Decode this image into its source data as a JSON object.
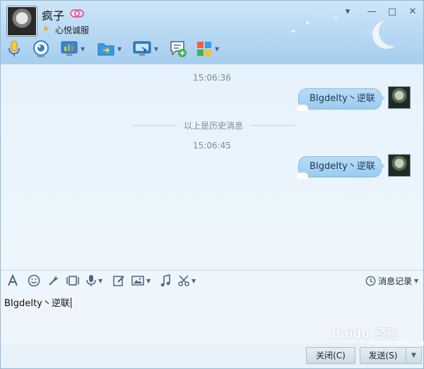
{
  "contact": {
    "name": "疯子",
    "signature": "心悦诚服"
  },
  "toolbar_top": {
    "icons": [
      "voice-call-icon",
      "video-call-icon",
      "remote-desktop-icon",
      "file-transfer-icon",
      "screen-share-icon",
      "group-chat-icon",
      "apps-icon"
    ]
  },
  "window_controls": {
    "dropdown": "▾",
    "minimize": "—",
    "maximize": "□",
    "close": "✕"
  },
  "messages": {
    "time_1": "15:06:36",
    "history_divider": "以上是历史消息",
    "time_2": "15:06:45",
    "msg_1": "BIgdeIty丶逆联",
    "msg_2": "BIgdeIty丶逆联"
  },
  "input_toolbar": {
    "message_record_label": "消息记录"
  },
  "input": {
    "value": "BIgdeIty丶逆联"
  },
  "buttons": {
    "close_label": "关闭(C)",
    "send_label": "发送(S)"
  },
  "watermark": {
    "brand": "Baidu 经验",
    "sub": "jingyan.baidu.com"
  },
  "colors": {
    "header": "#b6d8f3",
    "bubble": "#a6d2f1",
    "chat_bg": "#e6f2fb"
  }
}
